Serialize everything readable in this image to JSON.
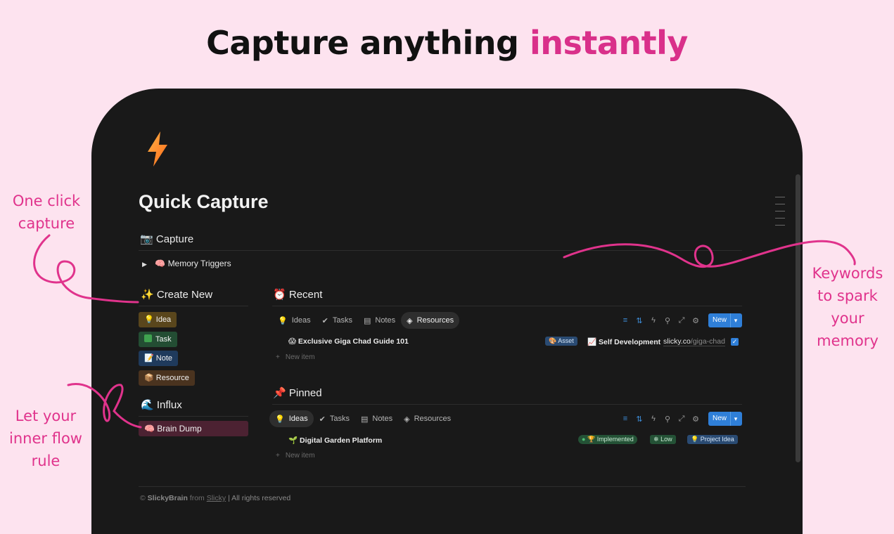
{
  "headline": {
    "main": "Capture anything",
    "accent": "instantly"
  },
  "annotations": {
    "one_click": "One click capture",
    "keywords": "Keywords to spark your memory",
    "flow": "Let your inner flow rule"
  },
  "page": {
    "title": "Quick Capture"
  },
  "capture_heading": "Capture",
  "memory_triggers": "Memory Triggers",
  "create_new": {
    "heading": "Create New",
    "buttons": [
      "Idea",
      "Task",
      "Note",
      "Resource"
    ]
  },
  "influx": {
    "heading": "Influx",
    "brain_dump": "Brain Dump"
  },
  "recent": {
    "heading": "Recent",
    "tabs": [
      "Ideas",
      "Tasks",
      "Notes",
      "Resources"
    ],
    "active_tab": "Resources",
    "new_button": "New",
    "row": {
      "title": "Exclusive Giga Chad Guide 101",
      "tag_type": "Asset",
      "area": "Self Development",
      "url_domain": "slicky.co",
      "url_path": "/giga-chad",
      "checked": true
    },
    "new_item": "New item"
  },
  "pinned": {
    "heading": "Pinned",
    "tabs": [
      "Ideas",
      "Tasks",
      "Notes",
      "Resources"
    ],
    "active_tab": "Ideas",
    "new_button": "New",
    "row": {
      "title": "Digital Garden Platform",
      "status": "Implemented",
      "priority": "Low",
      "category": "Project Idea"
    },
    "new_item": "New item"
  },
  "footer": {
    "brand": "SlickyBrain",
    "from": "from",
    "company": "Slicky",
    "rights": "| All rights reserved"
  },
  "colors": {
    "background": "#fde3ef",
    "accent_pink": "#d9308a",
    "frame": "#191919",
    "new_button_blue": "#2f7fd8",
    "idea_button": "#59461c",
    "task_button": "#234d33",
    "note_button": "#1f3a5c",
    "resource_button": "#4a331f",
    "brain_dump": "#4c2232"
  }
}
